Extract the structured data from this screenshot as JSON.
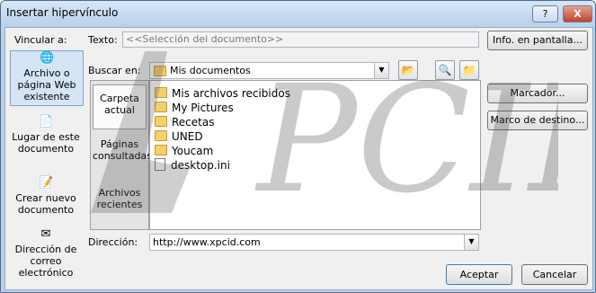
{
  "window": {
    "title": "Insertar hipervínculo",
    "help": "?",
    "close": "X"
  },
  "vincular_label": "Vincular a:",
  "sidebar": {
    "items": [
      {
        "line1": "Archivo o",
        "line2": "página Web",
        "line3": "existente"
      },
      {
        "line1": "Lugar de este",
        "line2": "documento"
      },
      {
        "line1": "Crear nuevo",
        "line2": "documento"
      },
      {
        "line1": "Dirección de",
        "line2": "correo",
        "line3": "electrónico"
      }
    ]
  },
  "texto": {
    "label": "Texto:",
    "value": "<<Selección del documento>>"
  },
  "info_button": "Info. en pantalla...",
  "buscar": {
    "label": "Buscar en:",
    "value": "Mis documentos"
  },
  "nav": {
    "items": [
      {
        "line1": "Carpeta",
        "line2": "actual"
      },
      {
        "line1": "Páginas",
        "line2": "consultadas"
      },
      {
        "line1": "Archivos",
        "line2": "recientes"
      }
    ]
  },
  "files": [
    "Mis archivos recibidos",
    "My Pictures",
    "Recetas",
    "UNED",
    "Youcam",
    "desktop.ini"
  ],
  "marcador_button": "Marcador...",
  "marco_button": "Marco de destino...",
  "direccion": {
    "label": "Dirección:",
    "value": "http://www.xpcid.com"
  },
  "aceptar_button": "Aceptar",
  "cancelar_button": "Cancelar",
  "watermark_text": "PCID",
  "icons": [
    "folder-up-icon",
    "browse-web-icon",
    "browse-file-icon",
    "existing-file-icon",
    "place-in-document-icon",
    "new-document-icon",
    "email-address-icon"
  ]
}
